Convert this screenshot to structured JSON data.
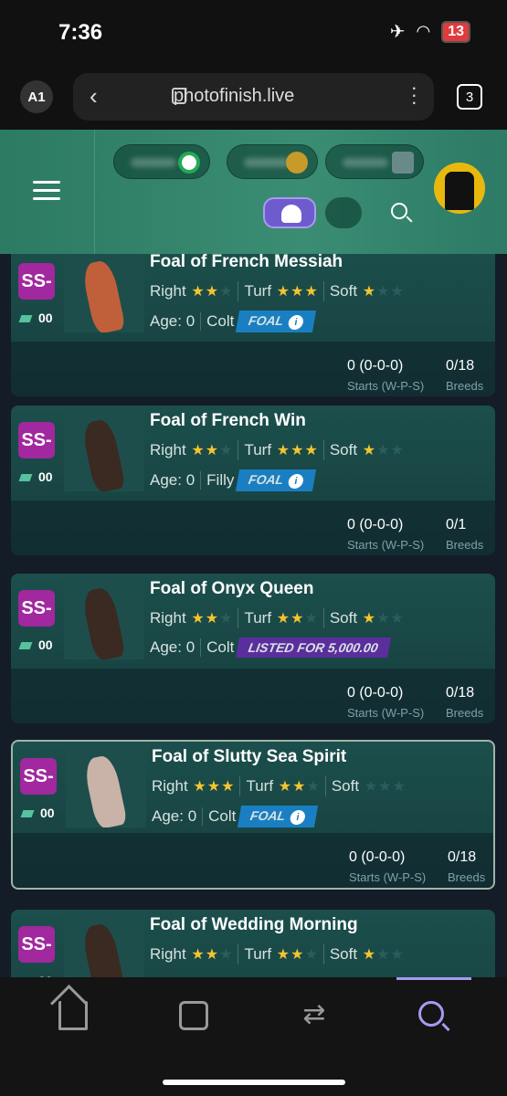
{
  "status": {
    "time": "7:36",
    "battery": "13"
  },
  "browser": {
    "profile": "A1",
    "url": "photofinish.live",
    "tabs": "3"
  },
  "cards": [
    {
      "badge": "SS-",
      "ff": "00",
      "name": "Foal of French Messiah",
      "dir": "Right",
      "surf": "Turf",
      "cond": "Soft",
      "dir_stars": 2,
      "surf_stars": 3,
      "cond_stars": 0.5,
      "age": "Age: 0",
      "sex": "Colt",
      "tag": "FOAL",
      "starts": "0 (0-0-0)",
      "breeds": "0/18",
      "horse_color": "#c0603a"
    },
    {
      "badge": "SS-",
      "ff": "00",
      "name": "Foal of French Win",
      "dir": "Right",
      "surf": "Turf",
      "cond": "Soft",
      "dir_stars": 1.5,
      "surf_stars": 2.5,
      "cond_stars": 0.5,
      "age": "Age: 0",
      "sex": "Filly",
      "tag": "FOAL",
      "starts": "0 (0-0-0)",
      "breeds": "0/1",
      "horse_color": "#3a2a22"
    },
    {
      "badge": "SS-",
      "ff": "00",
      "name": "Foal of Onyx Queen",
      "dir": "Right",
      "surf": "Turf",
      "cond": "Soft",
      "dir_stars": 2,
      "surf_stars": 2,
      "cond_stars": 0.5,
      "age": "Age: 0",
      "sex": "Colt",
      "tag": "LISTED FOR 5,000.00",
      "starts": "0 (0-0-0)",
      "breeds": "0/18",
      "horse_color": "#3a2a22"
    },
    {
      "badge": "SS-",
      "ff": "00",
      "name": "Foal of Slutty Sea Spirit",
      "dir": "Right",
      "surf": "Turf",
      "cond": "Soft",
      "dir_stars": 2.5,
      "surf_stars": 1.5,
      "cond_stars": 0,
      "age": "Age: 0",
      "sex": "Colt",
      "tag": "FOAL",
      "starts": "0 (0-0-0)",
      "breeds": "0/18",
      "horse_color": "#c9b3a8"
    },
    {
      "badge": "SS-",
      "ff": "00",
      "name": "Foal of Wedding Morning",
      "dir": "Right",
      "surf": "Turf",
      "cond": "Soft",
      "dir_stars": 2,
      "surf_stars": 2,
      "cond_stars": 1,
      "age": "",
      "sex": "",
      "tag": "",
      "starts": "",
      "breeds": "",
      "horse_color": "#3a2a22"
    }
  ],
  "labels": {
    "starts": "Starts (W-P-S)",
    "breeds": "Breeds"
  }
}
